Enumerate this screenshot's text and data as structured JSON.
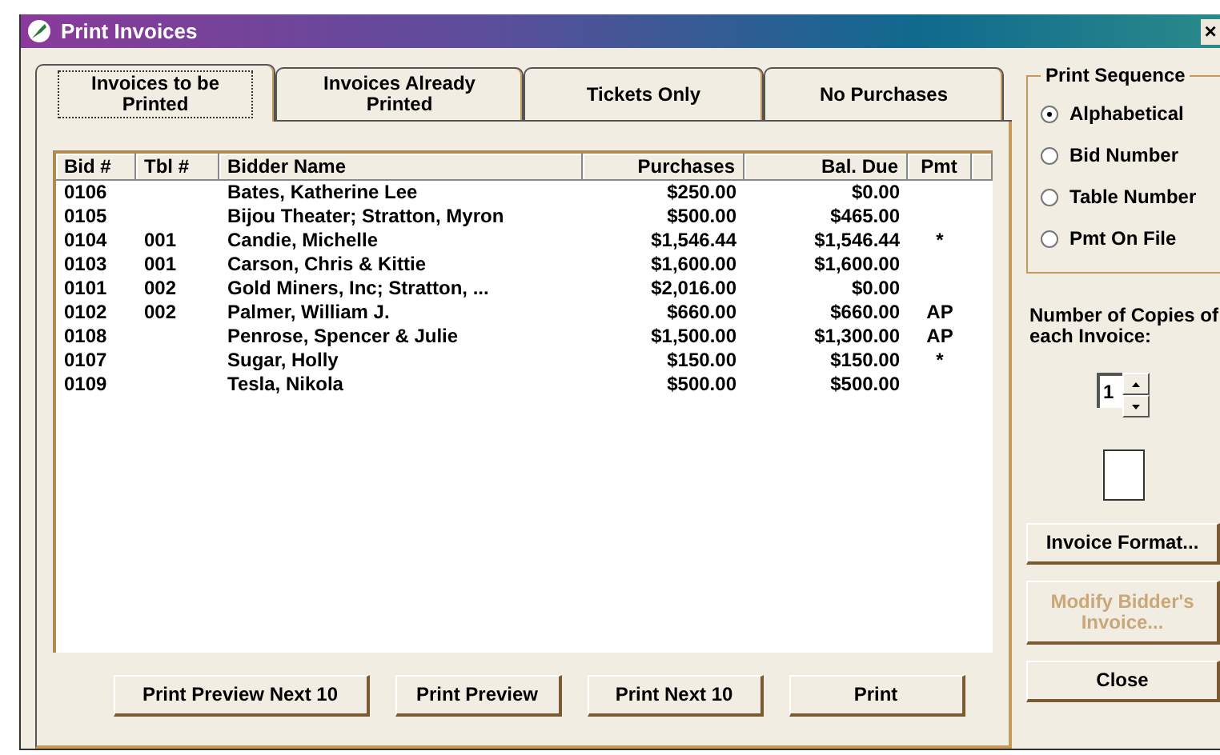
{
  "window": {
    "title": "Print Invoices",
    "close": "×"
  },
  "tabs": [
    {
      "label": "Invoices to be Printed",
      "selected": true
    },
    {
      "label": "Invoices Already Printed",
      "selected": false
    },
    {
      "label": "Tickets Only",
      "selected": false
    },
    {
      "label": "No Purchases",
      "selected": false
    }
  ],
  "table": {
    "columns": [
      "Bid #",
      "Tbl #",
      "Bidder Name",
      "Purchases",
      "Bal. Due",
      "Pmt"
    ],
    "rows": [
      [
        "0106",
        "",
        "Bates, Katherine Lee",
        "$250.00",
        "$0.00",
        ""
      ],
      [
        "0105",
        "",
        "Bijou Theater; Stratton, Myron",
        "$500.00",
        "$465.00",
        ""
      ],
      [
        "0104",
        "001",
        "Candie, Michelle",
        "$1,546.44",
        "$1,546.44",
        "*"
      ],
      [
        "0103",
        "001",
        "Carson, Chris & Kittie",
        "$1,600.00",
        "$1,600.00",
        ""
      ],
      [
        "0101",
        "002",
        "Gold Miners, Inc; Stratton, ...",
        "$2,016.00",
        "$0.00",
        ""
      ],
      [
        "0102",
        "002",
        "Palmer, William J.",
        "$660.00",
        "$660.00",
        "AP"
      ],
      [
        "0108",
        "",
        "Penrose, Spencer & Julie",
        "$1,500.00",
        "$1,300.00",
        "AP"
      ],
      [
        "0107",
        "",
        "Sugar, Holly",
        "$150.00",
        "$150.00",
        "*"
      ],
      [
        "0109",
        "",
        "Tesla, Nikola",
        "$500.00",
        "$500.00",
        ""
      ]
    ]
  },
  "bottom_buttons": [
    "Print Preview Next 10",
    "Print Preview",
    "Print Next 10",
    "Print"
  ],
  "print_sequence": {
    "title": "Print Sequence",
    "options": [
      {
        "label": "Alphabetical",
        "selected": true
      },
      {
        "label": "Bid Number",
        "selected": false
      },
      {
        "label": "Table Number",
        "selected": false
      },
      {
        "label": "Pmt On File",
        "selected": false
      }
    ]
  },
  "copies": {
    "label": "Number of Copies of each Invoice:",
    "value": "1"
  },
  "side_buttons": [
    {
      "label": "Invoice Format...",
      "disabled": false
    },
    {
      "label": "Modify Bidder's Invoice...",
      "disabled": true
    },
    {
      "label": "Close",
      "disabled": false
    }
  ]
}
